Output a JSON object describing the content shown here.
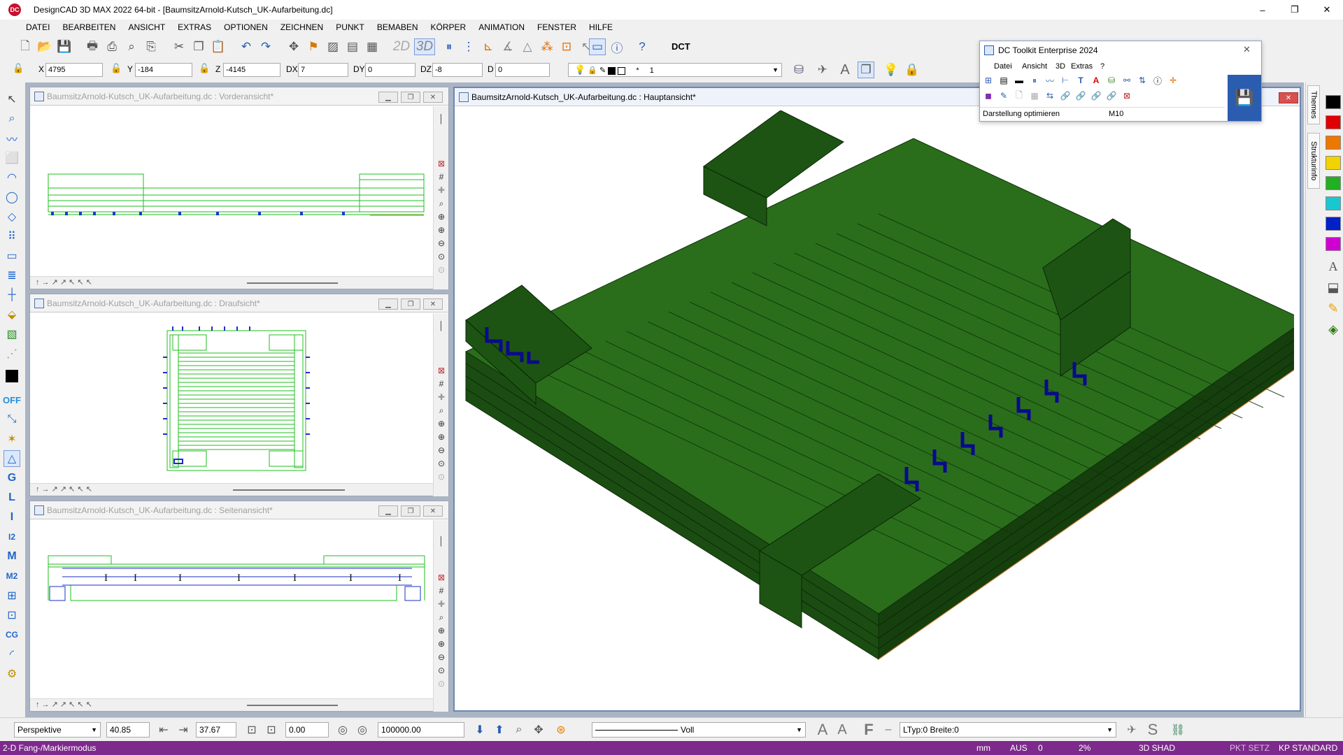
{
  "app": {
    "title": "DesignCAD 3D MAX 2022 64-bit - [BaumsitzArnold-Kutsch_UK-Aufarbeitung.dc]",
    "logo": "DC",
    "window_controls": {
      "minimize": "–",
      "restore": "❐",
      "close": "✕"
    }
  },
  "menu": [
    "DATEI",
    "BEARBEITEN",
    "ANSICHT",
    "EXTRAS",
    "OPTIONEN",
    "ZEICHNEN",
    "PUNKT",
    "BEMABEN",
    "KÖRPER",
    "ANIMATION",
    "FENSTER",
    "HILFE"
  ],
  "toolbar": {
    "mode_2d": "2D",
    "mode_3d": "3D",
    "dct_label": "DCT"
  },
  "coords": {
    "x_label": "X",
    "x_value": "4795",
    "y_label": "Y",
    "y_value": "-184",
    "z_label": "Z",
    "z_value": "-4145",
    "dx_label": "DX",
    "dx_value": "7",
    "dy_label": "DY",
    "dy_value": "0",
    "dz_label": "DZ",
    "dz_value": "-8",
    "d_label": "D",
    "d_value": "0",
    "layer_star": "*",
    "layer_value": "1"
  },
  "views": {
    "front": "BaumsitzArnold-Kutsch_UK-Aufarbeitung.dc : Vorderansicht*",
    "top": "BaumsitzArnold-Kutsch_UK-Aufarbeitung.dc : Draufsicht*",
    "side": "BaumsitzArnold-Kutsch_UK-Aufarbeitung.dc : Seitenansicht*",
    "main": "BaumsitzArnold-Kutsch_UK-Aufarbeitung.dc : Hauptansicht*"
  },
  "toolkit": {
    "title": "DC Toolkit Enterprise 2024",
    "menu": [
      "Datei",
      "Ansicht",
      "3D",
      "Extras",
      "?"
    ],
    "status_label": "Darstellung optimieren",
    "status_value": "M10",
    "close": "✕"
  },
  "right_tabs": {
    "themes": "Themes",
    "struktur": "Strukturinfo"
  },
  "color_palette": [
    "#000000",
    "#e00000",
    "#ee7700",
    "#f2d300",
    "#22b022",
    "#18c8d0",
    "#0020c8",
    "#d000d0"
  ],
  "bottom": {
    "projection": "Perspektive",
    "angle": "40.85",
    "lens": "37.67",
    "rotation": "0.00",
    "distance": "100000.00",
    "line_style": "Voll",
    "ltyp": "LTyp:0  Breite:0"
  },
  "status": {
    "mode": "2-D Fang-/Markiermodus",
    "unit": "mm",
    "aus": "AUS",
    "zero": "0",
    "percent": "2%",
    "shade": "3D SHAD",
    "pkt": "PKT SETZ",
    "kp": "KP STANDARD"
  },
  "colors": {
    "status_bar": "#7d2a8c",
    "model_green": "#2d7a1e",
    "model_dark": "#143f0d",
    "wireframe_green": "#1fbf1f",
    "steel_blue": "#0a0a8a"
  }
}
